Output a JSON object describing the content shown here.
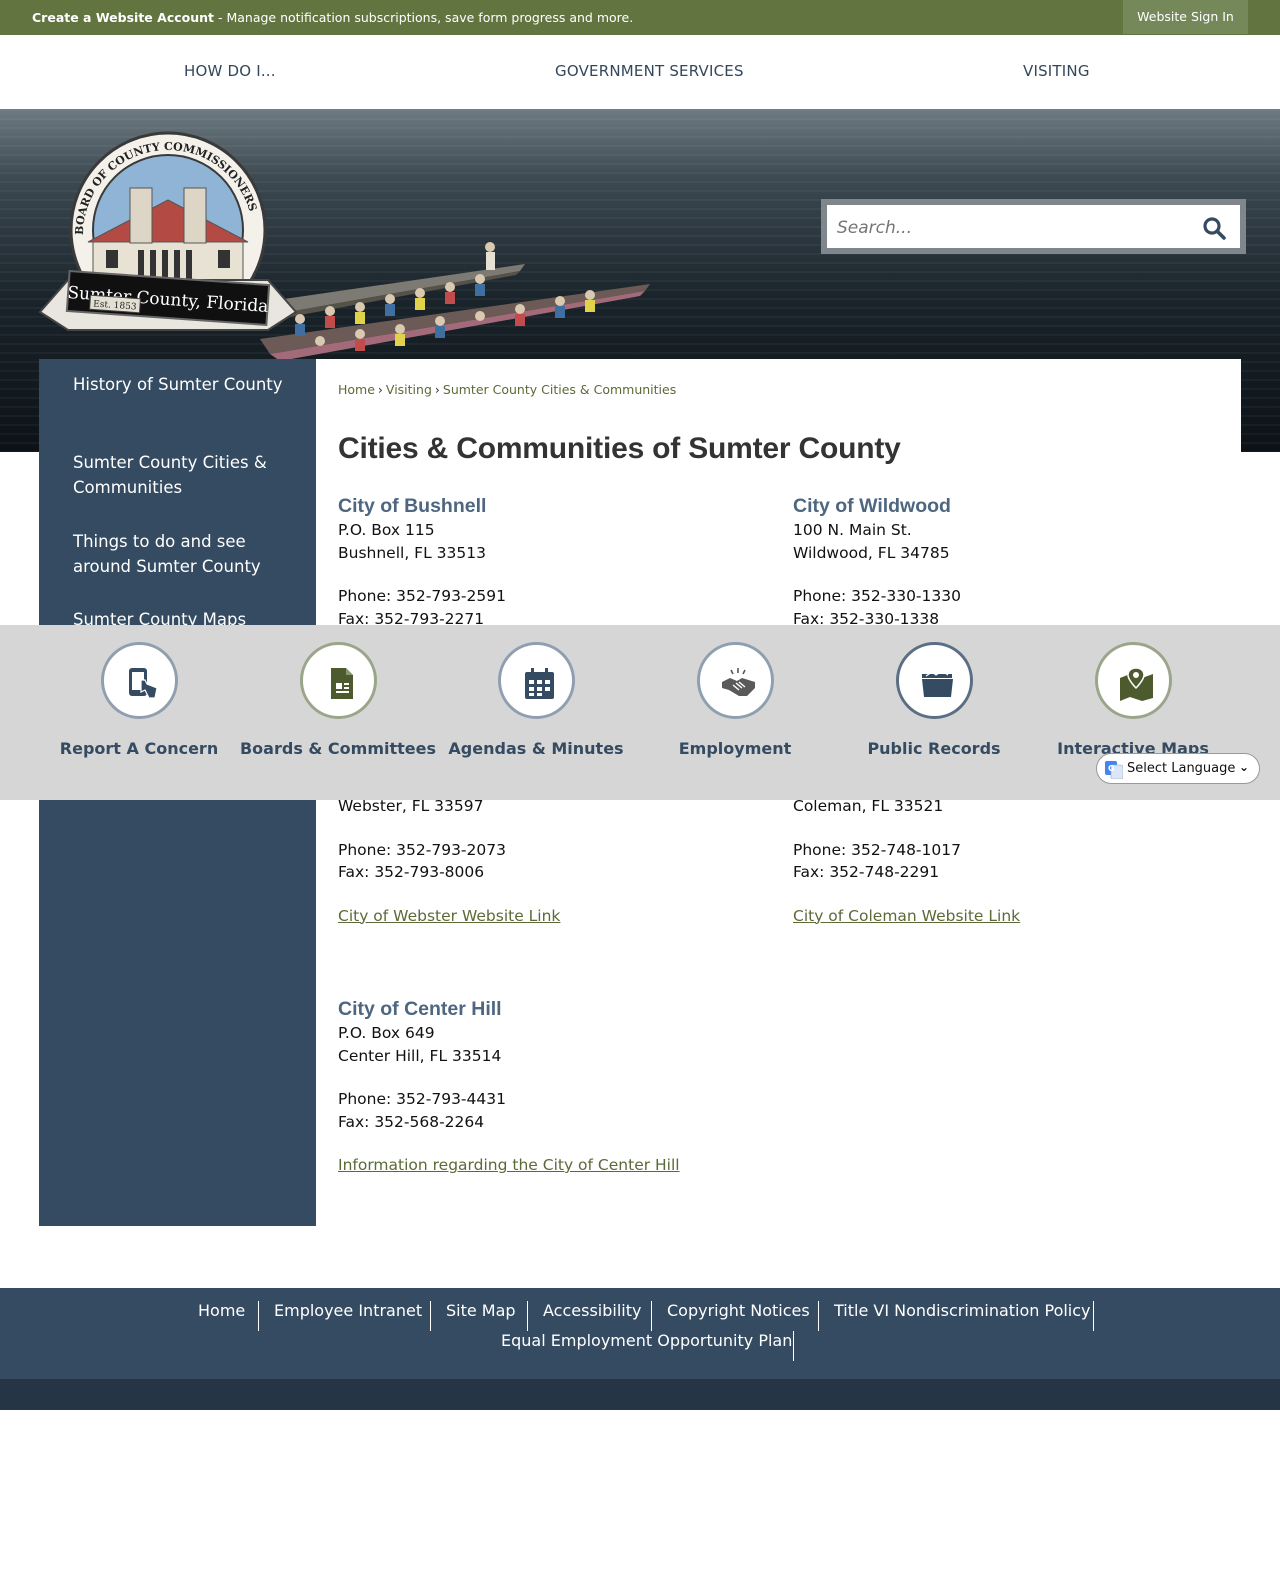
{
  "topbar": {
    "create_account": "Create a Website Account",
    "create_account_desc": " - Manage notification subscriptions, save form progress and more.",
    "sign_in": "Website Sign In"
  },
  "nav": {
    "items": [
      "HOW DO I...",
      "GOVERNMENT SERVICES",
      "VISITING"
    ]
  },
  "logo": {
    "arc_text": "BOARD OF COUNTY COMMISSIONERS",
    "banner_text": "Sumter County, Florida",
    "est": "Est. 1853"
  },
  "search": {
    "placeholder": "Search..."
  },
  "sidebar": {
    "items": [
      {
        "label": "History of Sumter County"
      },
      {
        "label": "Sumter County Cities & Communities"
      },
      {
        "label": "Things to do and see around Sumter County"
      },
      {
        "label": "Sumter County Maps"
      }
    ]
  },
  "breadcrumb": {
    "items": [
      "Home",
      "Visiting",
      "Sumter County Cities & Communities"
    ],
    "separator": "›"
  },
  "page": {
    "title": "Cities & Communities of Sumter County"
  },
  "cities": {
    "bushnell": {
      "name": "City of Bushnell",
      "address1": "P.O. Box 115",
      "address2": "Bushnell, FL 33513",
      "phone": "Phone: 352-793-2591",
      "fax": "Fax: 352-793-2271"
    },
    "wildwood": {
      "name": "City of Wildwood",
      "address1": "100 N. Main St.",
      "address2": "Wildwood, FL 34785",
      "phone": "Phone: 352-330-1330",
      "fax": "Fax: 352-330-1338"
    },
    "webster": {
      "address2": "Webster, FL 33597",
      "phone": "Phone: 352-793-2073",
      "fax": "Fax: 352-793-8006",
      "link": "City of Webster Website Link"
    },
    "coleman": {
      "address2": "Coleman, FL 33521",
      "phone": "Phone: 352-748-1017",
      "fax": "Fax: 352-748-2291",
      "link": "City of Coleman Website Link"
    },
    "centerhill": {
      "name": "City of Center Hill",
      "address1": "P.O. Box 649",
      "address2": "Center Hill, FL 33514",
      "phone": "Phone: 352-793-4431",
      "fax": "Fax: 352-568-2264",
      "link": "Information regarding the City of Center Hill"
    }
  },
  "quicklinks": {
    "items": [
      {
        "label": "Report A Concern",
        "icon": "phone-touch-icon"
      },
      {
        "label": "Boards & Committees",
        "icon": "document-icon"
      },
      {
        "label": "Agendas & Minutes",
        "icon": "calendar-icon"
      },
      {
        "label": "Employment",
        "icon": "handshake-icon"
      },
      {
        "label": "Public Records",
        "icon": "folder-icon"
      },
      {
        "label": "Interactive Maps",
        "icon": "map-pin-icon"
      }
    ]
  },
  "translate": {
    "label": "Select Language"
  },
  "footer": {
    "links": [
      "Home",
      "Employee Intranet",
      "Site Map",
      "Accessibility",
      "Copyright Notices",
      "Title VI Nondiscrimination Policy",
      "Equal Employment Opportunity Plan"
    ]
  },
  "colors": {
    "topbar": "#627541",
    "navy": "#344b61",
    "link_olive": "#5b6a36",
    "city_heading": "#4e6680"
  }
}
